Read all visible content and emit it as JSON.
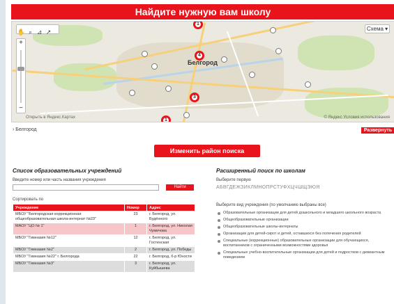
{
  "header": {
    "title": "Найдите нужную вам школу"
  },
  "map": {
    "city_label": "Белгород",
    "layers_label": "Схема",
    "toolbar_icons": [
      "hand-icon",
      "magnifier-icon",
      "ruler-icon",
      "route-icon"
    ],
    "zoom_plus": "+",
    "zoom_minus": "−",
    "caption": "Открыть в Яндекс.Картах",
    "copyright": "© Яндекс   Условия использования",
    "pins": [
      "1",
      "4",
      "3",
      "1"
    ]
  },
  "breadcrumb": "› Белгород",
  "expand_button": "Развернуть",
  "change_area_button": "Изменить район поиска",
  "left": {
    "title": "Список образовательных учреждений",
    "search_label": "Введите номер или часть названия учреждения",
    "search_placeholder": "",
    "find_button": "Найти",
    "sort_label": "Сортировать по",
    "table": {
      "headers": [
        "Учреждение",
        "Номер",
        "Адрес"
      ],
      "rows": [
        {
          "name": "МБОУ \"Белгородская коррекционная общеобразовательная школа-интернат №23\"",
          "num": "23",
          "addr": "г. Белгород, ул. Будённого",
          "style": "white"
        },
        {
          "name": "МАОУ \"ЦО № 1\"",
          "num": "1",
          "addr": "г. Белгород, ул. Николая Чумичова",
          "style": "pink"
        },
        {
          "name": "МБОУ \"Гимназия №12\"",
          "num": "12",
          "addr": "г. Белгород, ул. Гостенская",
          "style": "white"
        },
        {
          "name": "МБОУ \"Гимназия №2\"",
          "num": "2",
          "addr": "г. Белгород, ул. Победы",
          "style": "gray"
        },
        {
          "name": "МБОУ \"Гимназия №22\" г. Белгорода",
          "num": "22",
          "addr": "г. Белгород, б-р Юности",
          "style": "white"
        },
        {
          "name": "МБОУ \"Гимназия №3\"",
          "num": "3",
          "addr": "г. Белгород, ул. Куйбышева",
          "style": "gray"
        }
      ]
    }
  },
  "right": {
    "title": "Расширенный поиск по школам",
    "letter_label": "Выберите первую",
    "alphabet": "АБВГДЕЖЗИКЛМНОПРСТУФХЦЧШЩЭЮЯ",
    "type_label": "Выберите вид учреждения (по умолчанию выбраны все)",
    "types": [
      "Образовательные организации для детей дошкольного и младшего школьного возраста",
      "Общеобразовательные организации",
      "Общеобразовательные школы-интернаты",
      "Организации для детей-сирот и детей, оставшихся без попечения родителей",
      "Специальные (коррекционные) образовательные организации для обучающихся, воспитанников с ограниченными возможностями здоровья",
      "Специальные учебно-воспитательные организации для детей и подростков с девиантным поведением"
    ]
  },
  "colors": {
    "accent": "#e8131b",
    "pink_row": "#f7c6c8",
    "gray_row": "#dddddd"
  }
}
